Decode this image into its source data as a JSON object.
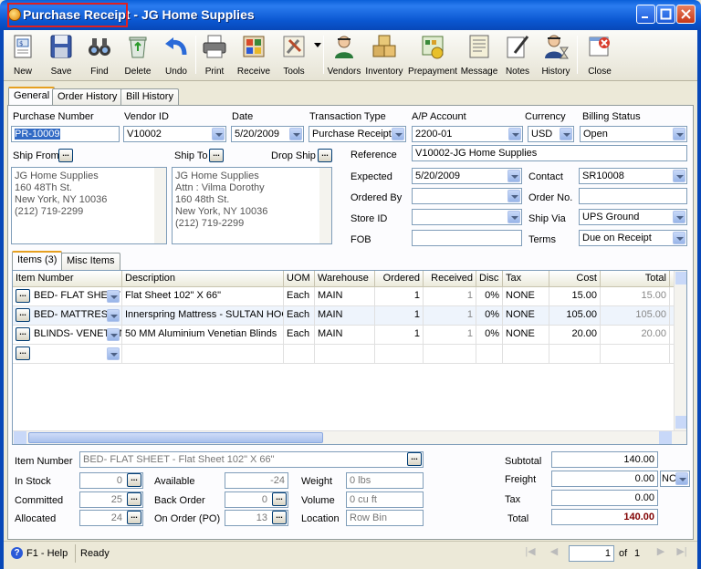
{
  "window": {
    "title": "Purchase Receipt",
    "subtitle": " - JG Home Supplies"
  },
  "toolbar": [
    {
      "label": "New",
      "icon": "new-doc-icon"
    },
    {
      "label": "Save",
      "icon": "floppy-disk-icon"
    },
    {
      "label": "Find",
      "icon": "binoculars-icon"
    },
    {
      "label": "Delete",
      "icon": "recycle-bin-icon"
    },
    {
      "label": "Undo",
      "icon": "undo-arrow-icon"
    },
    {
      "label": "Print",
      "icon": "printer-icon"
    },
    {
      "label": "Receive",
      "icon": "receive-icon"
    },
    {
      "label": "Tools",
      "icon": "tools-icon"
    },
    {
      "label": "Vendors",
      "icon": "vendor-person-icon"
    },
    {
      "label": "Inventory",
      "icon": "boxes-icon"
    },
    {
      "label": "Prepayment",
      "icon": "prepayment-icon"
    },
    {
      "label": "Message",
      "icon": "message-icon"
    },
    {
      "label": "Notes",
      "icon": "notes-pen-icon"
    },
    {
      "label": "History",
      "icon": "history-person-icon"
    },
    {
      "label": "Close",
      "icon": "close-window-icon"
    }
  ],
  "tabs": [
    "General",
    "Order History",
    "Bill History"
  ],
  "form": {
    "purchase_number_label": "Purchase Number",
    "purchase_number": "PR-10009",
    "vendor_id_label": "Vendor ID",
    "vendor_id": "V10002",
    "date_label": "Date",
    "date": "5/20/2009",
    "transaction_type_label": "Transaction Type",
    "transaction_type": "Purchase Receipt",
    "ap_account_label": "A/P Account",
    "ap_account": "2200-01",
    "currency_label": "Currency",
    "currency": "USD",
    "billing_status_label": "Billing Status",
    "billing_status": "Open",
    "ship_from_label": "Ship From",
    "ship_from": "JG Home Supplies\n160 48Th St.\nNew York, NY 10036\n(212) 719-2299",
    "ship_to_label": "Ship To",
    "ship_to": "JG Home Supplies\nAttn : Vilma Dorothy\n160 48th St.\nNew York, NY 10036\n(212) 719-2299",
    "drop_ship_label": "Drop Ship",
    "reference_label": "Reference",
    "reference": "V10002-JG Home Supplies",
    "expected_label": "Expected",
    "expected": "5/20/2009",
    "contact_label": "Contact",
    "contact": "SR10008",
    "ordered_by_label": "Ordered By",
    "ordered_by": "",
    "order_no_label": "Order No.",
    "order_no": "",
    "store_id_label": "Store ID",
    "store_id": "",
    "ship_via_label": "Ship Via",
    "ship_via": "UPS Ground",
    "fob_label": "FOB",
    "fob": "",
    "terms_label": "Terms",
    "terms": "Due on Receipt"
  },
  "item_tabs": [
    "Items (3)",
    "Misc Items"
  ],
  "grid": {
    "columns": [
      "Item Number",
      "Description",
      "UOM",
      "Warehouse",
      "Ordered",
      "Received",
      "Disc",
      "Tax",
      "Cost",
      "Total"
    ],
    "rows": [
      {
        "item": "BED- FLAT SHEET",
        "desc": "Flat Sheet 102\" X 66\"",
        "uom": "Each",
        "wh": "MAIN",
        "ordered": "1",
        "received": "1",
        "disc": "0%",
        "tax": "NONE",
        "cost": "15.00",
        "total": "15.00"
      },
      {
        "item": "BED- MATTRESS",
        "desc": "Innerspring Mattress - SULTAN HOG",
        "uom": "Each",
        "wh": "MAIN",
        "ordered": "1",
        "received": "1",
        "disc": "0%",
        "tax": "NONE",
        "cost": "105.00",
        "total": "105.00"
      },
      {
        "item": "BLINDS- VENETIAN",
        "desc": "50 MM Aluminium Venetian Blinds",
        "uom": "Each",
        "wh": "MAIN",
        "ordered": "1",
        "received": "1",
        "disc": "0%",
        "tax": "NONE",
        "cost": "20.00",
        "total": "20.00"
      }
    ]
  },
  "detail": {
    "item_number_label": "Item Number",
    "item_number": "BED- FLAT SHEET - Flat Sheet 102\" X 66\"",
    "in_stock_label": "In Stock",
    "in_stock": "0",
    "committed_label": "Committed",
    "committed": "25",
    "allocated_label": "Allocated",
    "allocated": "24",
    "available_label": "Available",
    "available": "-24",
    "back_order_label": "Back Order",
    "back_order": "0",
    "on_order_label": "On Order (PO)",
    "on_order": "13",
    "weight_label": "Weight",
    "weight": "0 lbs",
    "volume_label": "Volume",
    "volume": "0 cu ft",
    "location_label": "Location",
    "location": "Row  Bin"
  },
  "totals": {
    "subtotal_label": "Subtotal",
    "subtotal": "140.00",
    "freight_label": "Freight",
    "freight": "0.00",
    "freight_code": "NC",
    "tax_label": "Tax",
    "tax": "0.00",
    "total_label": "Total",
    "total": "140.00"
  },
  "status": {
    "help": "F1 - Help",
    "state": "Ready",
    "page": "1",
    "of_label": "of",
    "page_count": "1"
  }
}
